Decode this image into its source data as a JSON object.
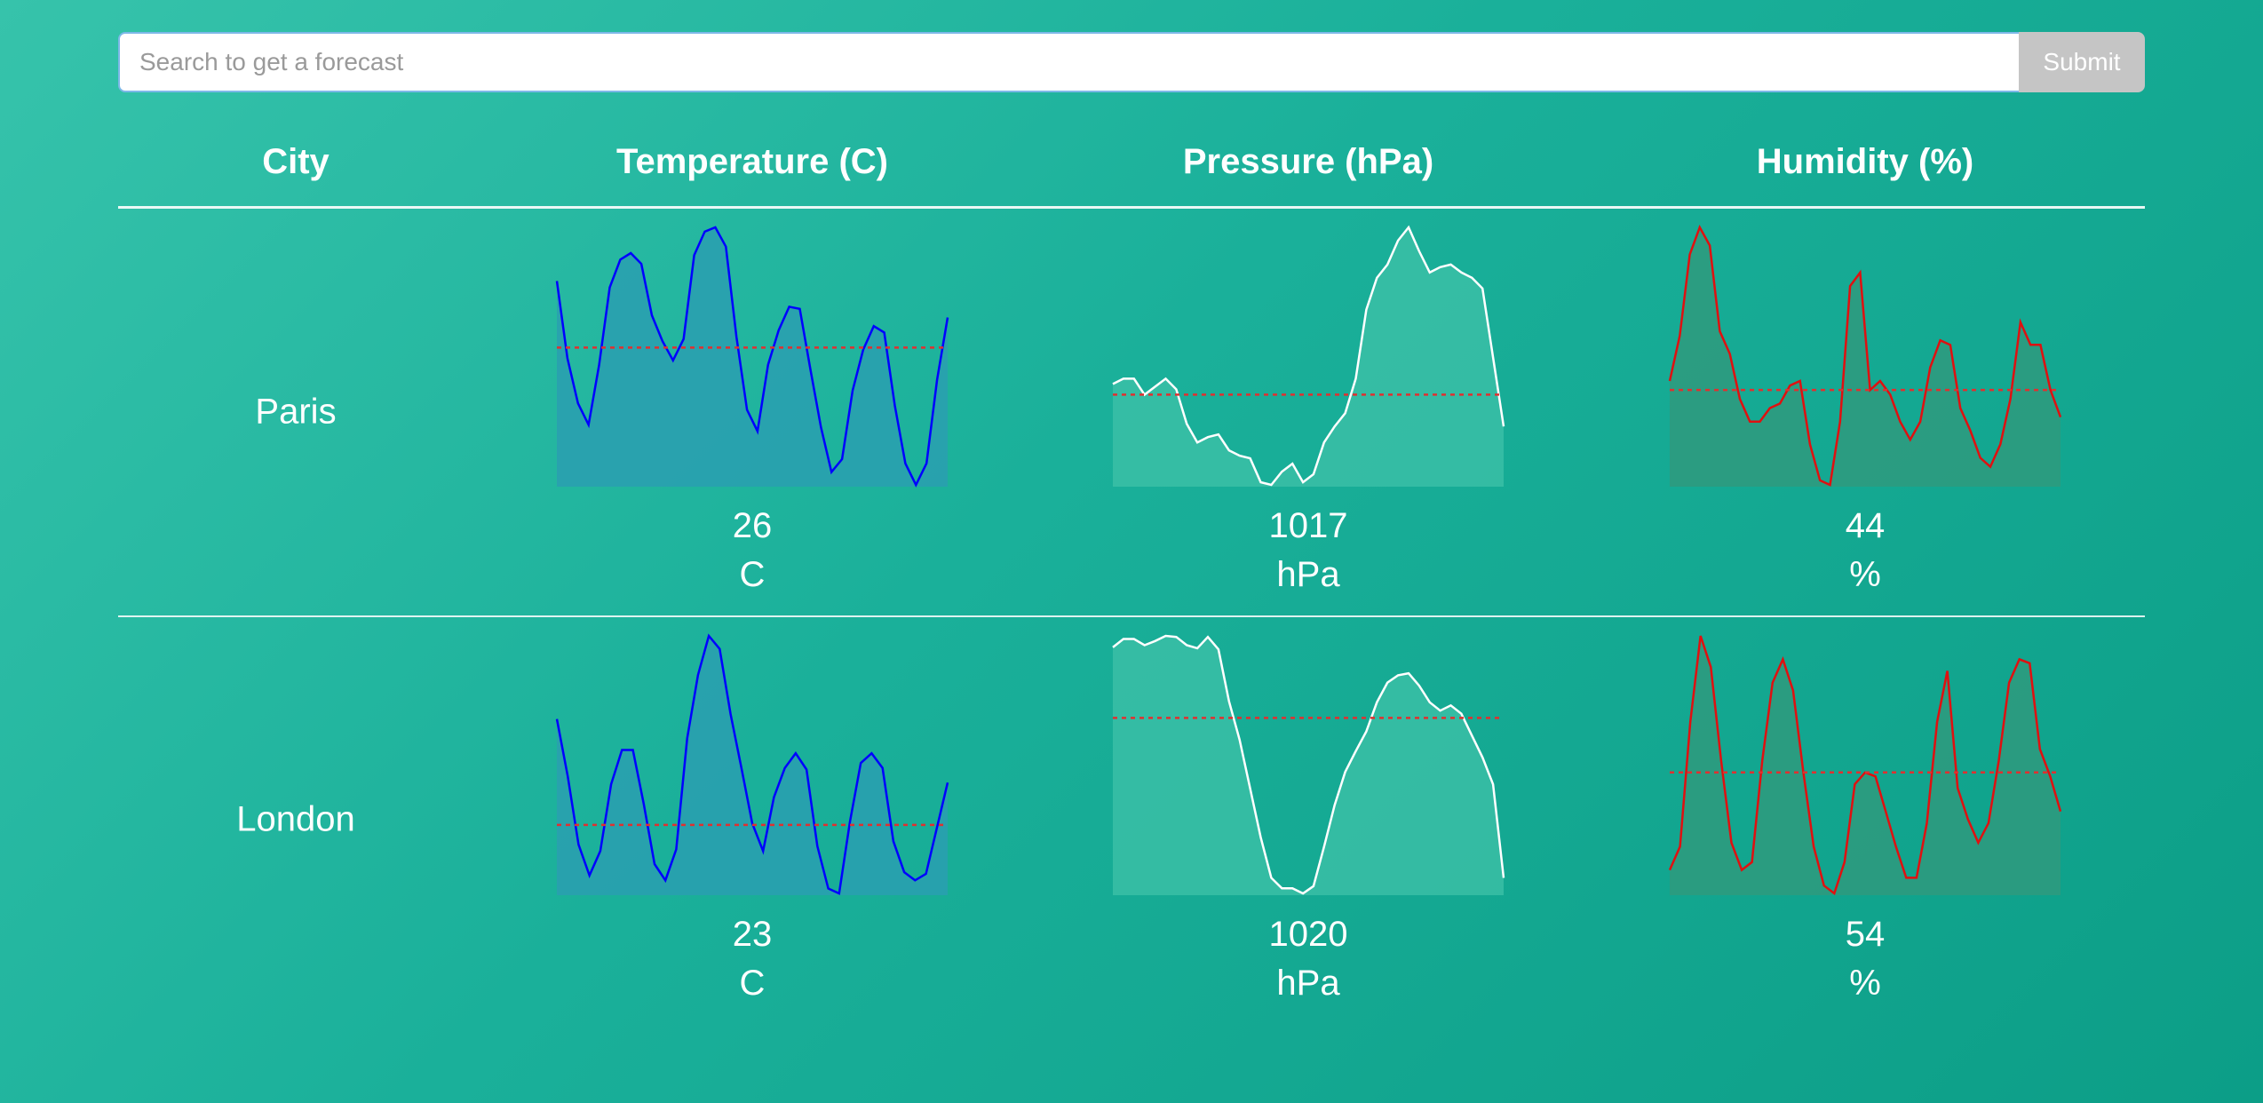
{
  "search": {
    "placeholder": "Search to get a forecast",
    "value": "",
    "submit_label": "Submit"
  },
  "table": {
    "headers": {
      "city": "City",
      "temperature": "Temperature (C)",
      "pressure": "Pressure (hPa)",
      "humidity": "Humidity (%)"
    },
    "rows": [
      {
        "city": "Paris",
        "temperature": {
          "average": "26",
          "unit": "C"
        },
        "pressure": {
          "average": "1017",
          "unit": "hPa"
        },
        "humidity": {
          "average": "44",
          "unit": "%"
        }
      },
      {
        "city": "London",
        "temperature": {
          "average": "23",
          "unit": "C"
        },
        "pressure": {
          "average": "1020",
          "unit": "hPa"
        },
        "humidity": {
          "average": "54",
          "unit": "%"
        }
      }
    ]
  },
  "colors": {
    "temperature_line": "#0000ff",
    "temperature_fill": "#2a9fb0",
    "pressure_line": "#ffffff",
    "pressure_fill": "#3fc2a8",
    "humidity_line": "#e01010",
    "humidity_fill": "#2f9a7e",
    "average_line": "#e03030"
  },
  "chart_data": [
    {
      "type": "area",
      "city": "Paris",
      "metric": "temperature",
      "values": [
        28.5,
        24.9,
        22.8,
        21.8,
        24.6,
        28.2,
        29.5,
        29.8,
        29.3,
        26.9,
        25.7,
        24.8,
        25.8,
        29.7,
        30.8,
        31.0,
        30.1,
        25.9,
        22.5,
        21.5,
        24.6,
        26.2,
        27.3,
        27.2,
        24.4,
        21.7,
        19.6,
        20.2,
        23.4,
        25.3,
        26.4,
        26.1,
        22.7,
        20.0,
        19.0,
        20.0,
        23.9,
        26.8
      ],
      "average": 25.4
    },
    {
      "type": "area",
      "city": "Paris",
      "metric": "pressure",
      "values": [
        1018.7,
        1018.9,
        1018.9,
        1018.3,
        1018.6,
        1018.9,
        1018.5,
        1017.2,
        1016.5,
        1016.7,
        1016.8,
        1016.2,
        1016.0,
        1015.9,
        1015.0,
        1014.9,
        1015.4,
        1015.7,
        1015.0,
        1015.3,
        1016.5,
        1017.1,
        1017.6,
        1018.9,
        1021.5,
        1022.7,
        1023.2,
        1024.1,
        1024.6,
        1023.7,
        1022.9,
        1023.1,
        1023.2,
        1022.9,
        1022.7,
        1022.3,
        1019.7,
        1017.1
      ],
      "average": 1018.3
    },
    {
      "type": "area",
      "city": "Paris",
      "metric": "humidity",
      "values": [
        54,
        64,
        82,
        88,
        84,
        65,
        60,
        50,
        45,
        45,
        48,
        49,
        53,
        54,
        40,
        32,
        31,
        45,
        75,
        78,
        52,
        54,
        51,
        45,
        41,
        45,
        57,
        63,
        62,
        48,
        43,
        37,
        35,
        40,
        50,
        67,
        62,
        62,
        52,
        46
      ],
      "average": 52
    },
    {
      "type": "area",
      "city": "London",
      "metric": "temperature",
      "values": [
        26.5,
        23.0,
        18.8,
        16.9,
        18.4,
        22.5,
        24.6,
        24.6,
        21.3,
        17.6,
        16.6,
        18.5,
        25.3,
        29.2,
        31.6,
        30.8,
        26.8,
        23.5,
        20.1,
        18.4,
        21.7,
        23.5,
        24.4,
        23.4,
        18.7,
        16.1,
        15.8,
        20.2,
        23.8,
        24.4,
        23.5,
        19.0,
        17.1,
        16.6,
        17.0,
        19.8,
        22.6
      ],
      "average": 20.0
    },
    {
      "type": "area",
      "city": "London",
      "metric": "pressure",
      "values": [
        1031.2,
        1032.0,
        1032.0,
        1031.4,
        1031.8,
        1032.3,
        1032.2,
        1031.4,
        1031.1,
        1032.2,
        1031.0,
        1026.0,
        1022.3,
        1017.6,
        1012.9,
        1009.0,
        1008.0,
        1008.0,
        1007.5,
        1008.2,
        1012.0,
        1016.0,
        1019.2,
        1021.2,
        1023.1,
        1025.9,
        1027.8,
        1028.5,
        1028.7,
        1027.5,
        1025.9,
        1025.1,
        1025.6,
        1024.8,
        1022.7,
        1020.6,
        1018.0,
        1009.0
      ],
      "average": 1024.4
    },
    {
      "type": "area",
      "city": "London",
      "metric": "humidity",
      "values": [
        32,
        38,
        70,
        92,
        84,
        60,
        39,
        32,
        34,
        60,
        80,
        86,
        78,
        57,
        38,
        28,
        26,
        34,
        54,
        57,
        56,
        47,
        38,
        30,
        30,
        44,
        70,
        83,
        53,
        45,
        39,
        44,
        60,
        80,
        86,
        85,
        63,
        56,
        47
      ],
      "average": 57
    }
  ]
}
